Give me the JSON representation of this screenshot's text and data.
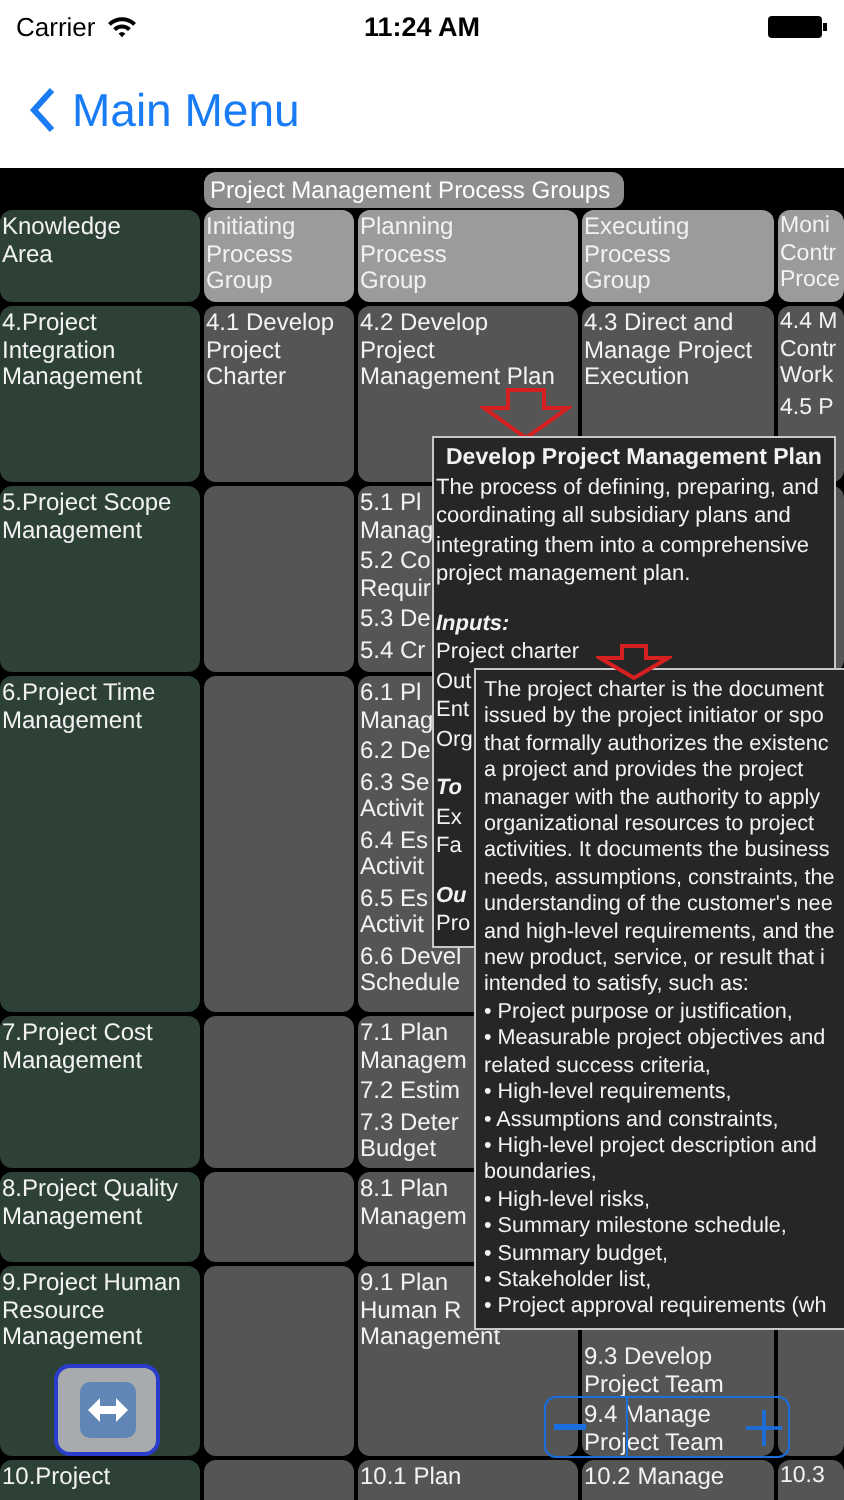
{
  "status_bar": {
    "carrier": "Carrier",
    "time": "11:24 AM"
  },
  "nav_bar": {
    "back_label": "Main Menu"
  },
  "matrix": {
    "group_title": "Project Management Process Groups",
    "headers": [
      "Knowledge\nArea",
      "Initiating\nProcess\nGroup",
      "Planning\nProcess\nGroup",
      "Executing\nProcess\nGroup",
      "Moni\nContr\nProce"
    ],
    "rows": [
      {
        "area": "4.Project\nIntegration\nManagement",
        "cells": [
          [
            "4.1 Develop\nProject\nCharter"
          ],
          [
            "4.2 Develop\nProject\nManagement Plan"
          ],
          [
            "4.3 Direct and\nManage Project\nExecution"
          ],
          [
            "4.4 M\nContr\nWork",
            "4.5 P"
          ]
        ]
      },
      {
        "area": "5.Project Scope\nManagement",
        "cells": [
          [],
          [
            "5.1 Pl\nManag",
            "5.2 Co\nRequir",
            "5.3 De",
            "5.4 Cr"
          ],
          [],
          []
        ]
      },
      {
        "area": "6.Project Time\nManagement",
        "cells": [
          [],
          [
            "6.1 Pl\nManag",
            "6.2 De",
            "6.3 Se\nActivit",
            "6.4 Es\nActivit",
            "6.5 Es\nActivit",
            "6.6 Devel\nSchedule"
          ],
          [],
          []
        ]
      },
      {
        "area": "7.Project Cost\nManagement",
        "cells": [
          [],
          [
            "7.1 Plan\nManagem",
            "7.2 Estim",
            "7.3 Deter\nBudget"
          ],
          [],
          []
        ]
      },
      {
        "area": "8.Project Quality\nManagement",
        "cells": [
          [],
          [
            "8.1 Plan\nManagem"
          ],
          [],
          []
        ]
      },
      {
        "area": "9.Project Human\nResource\nManagement",
        "cells": [
          [],
          [
            "9.1 Plan\nHuman R\nManagement"
          ],
          [
            "9.3 Develop\nProject Team",
            "9.4 Manage\nProject Team"
          ],
          []
        ]
      },
      {
        "area": "10.Project",
        "cells": [
          [],
          [
            "10.1 Plan"
          ],
          [
            "10.2 Manage"
          ],
          [
            "10.3"
          ]
        ]
      }
    ]
  },
  "popups": [
    {
      "title": "Develop Project Management Plan",
      "blocks": [
        {
          "kind": "text",
          "text": "The process of defining, preparing, and coordinating all subsidiary plans and integrating them into a comprehensive project management plan."
        },
        {
          "kind": "heading",
          "text": "Inputs:"
        },
        {
          "kind": "text",
          "text": "Project charter"
        },
        {
          "kind": "text",
          "text": "Out"
        },
        {
          "kind": "text",
          "text": "Ent"
        },
        {
          "kind": "text",
          "text": "Org"
        },
        {
          "kind": "heading",
          "text": "To"
        },
        {
          "kind": "text",
          "text": "Ex"
        },
        {
          "kind": "text",
          "text": "Fa"
        },
        {
          "kind": "heading",
          "text": "Ou"
        },
        {
          "kind": "text",
          "text": "Pro"
        }
      ]
    },
    {
      "blocks": [
        {
          "kind": "text",
          "text": "The project charter is the document\nissued by the project initiator or spo\nthat formally authorizes the existenc\na project and provides the project\nmanager with the authority to apply\norganizational resources to project\nactivities. It documents the business\nneeds, assumptions, constraints, the\nunderstanding of the customer's nee\nand high-level requirements, and the\nnew product, service, or result that i\nintended to satisfy, such as:\n• Project purpose or justification,\n• Measurable project objectives and\nrelated success criteria,\n• High-level requirements,\n• Assumptions and constraints,\n• High-level project description and\nboundaries,\n• High-level risks,\n• Summary milestone schedule,\n• Summary budget,\n• Stakeholder list,\n• Project approval requirements (wh"
        }
      ]
    }
  ]
}
